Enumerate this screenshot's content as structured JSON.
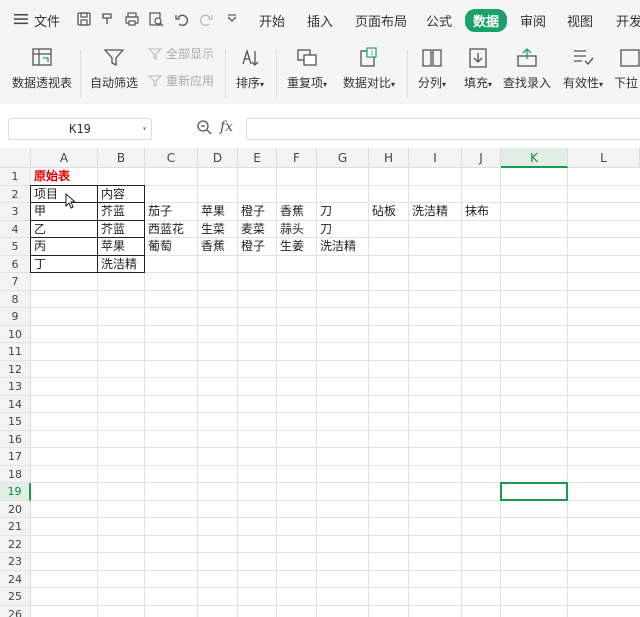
{
  "menubar": {
    "file_label": "文件",
    "tabs": [
      "开始",
      "插入",
      "页面布局",
      "公式",
      "数据",
      "审阅",
      "视图",
      "开发"
    ],
    "active_tab": "数据"
  },
  "ribbon": {
    "pivot": "数据透视表",
    "autofilter": "自动筛选",
    "show_all": "全部显示",
    "reapply": "重新应用",
    "sort": "排序",
    "duplicates": "重复项",
    "compare": "数据对比",
    "split": "分列",
    "fill": "填充",
    "lookup": "查找录入",
    "validity": "有效性",
    "dropdown": "下拉"
  },
  "formula_bar": {
    "name_box": "K19",
    "fx_label": "fx",
    "value": ""
  },
  "sheet": {
    "columns": [
      "A",
      "B",
      "C",
      "D",
      "E",
      "F",
      "G",
      "H",
      "I",
      "J",
      "K",
      "L"
    ],
    "selected_column": "K",
    "rows": [
      "1",
      "2",
      "3",
      "4",
      "5",
      "6",
      "7",
      "8",
      "9",
      "10",
      "11",
      "12",
      "13",
      "14",
      "15",
      "16",
      "17",
      "18",
      "19",
      "20",
      "21",
      "22",
      "23",
      "24",
      "25",
      "26"
    ],
    "selected_row": "19",
    "cells": {
      "A1": "原始表",
      "A2": "项目",
      "B2": "内容",
      "A3": "甲",
      "B3": "芥蓝",
      "C3": "茄子",
      "D3": "苹果",
      "E3": "橙子",
      "F3": "香蕉",
      "G3": "刀",
      "H3": "砧板",
      "I3": "洗洁精",
      "J3": "抹布",
      "A4": "乙",
      "B4": "芥蓝",
      "C4": "西蓝花",
      "D4": "生菜",
      "E4": "麦菜",
      "F4": "蒜头",
      "G4": "刀",
      "A5": "丙",
      "B5": "苹果",
      "C5": "葡萄",
      "D5": "香蕉",
      "E5": "橙子",
      "F5": "生姜",
      "G5": "洗洁精",
      "A6": "丁",
      "B6": "洗洁精"
    }
  }
}
